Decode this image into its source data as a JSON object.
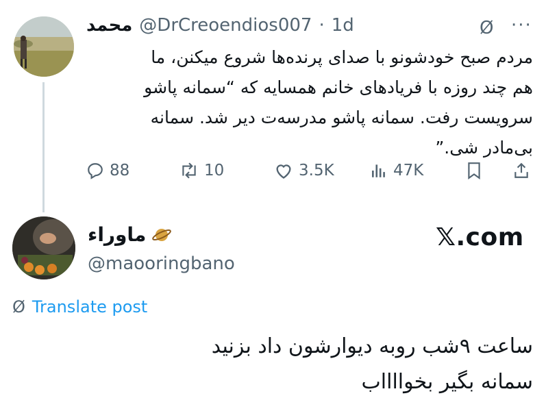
{
  "tweet": {
    "display_name": "محمد",
    "handle": "@DrCreoendios007",
    "separator": "·",
    "time": "1d",
    "text": "مردم صبح خودشونو با صدای پرنده‌ها شروع میکنن، ما\nهم چند روزه با فریادهای خانم همسایه که “سمانه پاشو\nسرویست رفت. سمانه پاشو مدرسه‌ت دیر شد. سمانه\nبی‌مادر شی.”",
    "actions": {
      "replies": "88",
      "retweets": "10",
      "likes": "3.5K",
      "views": "47K"
    },
    "icons": {
      "grok": "sync-slash-icon",
      "more": "more-icon",
      "reply": "reply-icon",
      "retweet": "retweet-icon",
      "like": "heart-icon",
      "views": "views-icon",
      "bookmark": "bookmark-icon",
      "share": "share-icon"
    }
  },
  "reply": {
    "display_name": "ماوراء",
    "handle": "@maooringbano",
    "watermark": "𝕏.com",
    "translate_label": "Translate post",
    "text": "ساعت ۹شب روبه دیوارشون داد بزنید\nسمانه بگیر بخوااااب"
  },
  "colors": {
    "text": "#0f1419",
    "muted": "#536471",
    "link": "#1d9bf0",
    "thread_line": "#cfd9de"
  }
}
